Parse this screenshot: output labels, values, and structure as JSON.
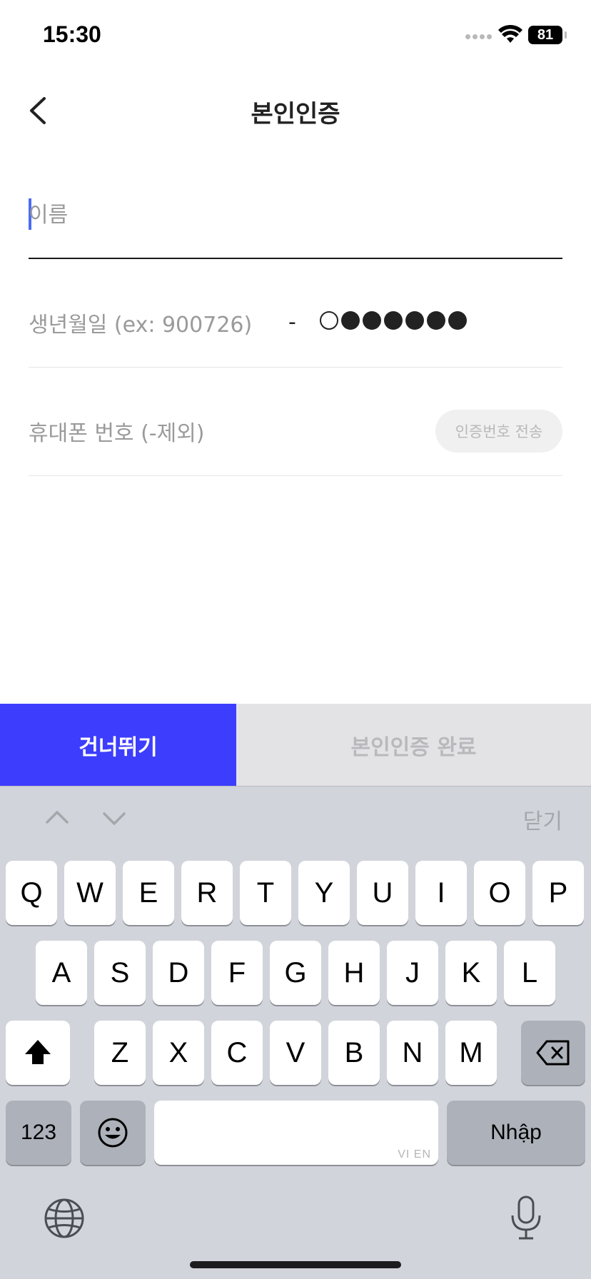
{
  "status_bar": {
    "time": "15:30",
    "battery": "81"
  },
  "nav": {
    "title": "본인인증"
  },
  "form": {
    "name_placeholder": "이름",
    "birth_placeholder": "생년월일 (ex: 900726)",
    "rrn_separator": "-",
    "rrn_dots": [
      "empty",
      "filled",
      "filled",
      "filled",
      "filled",
      "filled",
      "filled"
    ],
    "phone_placeholder": "휴대폰 번호 (-제외)",
    "send_code_label": "인증번호 전송"
  },
  "actions": {
    "skip_label": "건너뛰기",
    "complete_label": "본인인증 완료"
  },
  "accessory": {
    "close_label": "닫기"
  },
  "keyboard": {
    "row1": [
      "Q",
      "W",
      "E",
      "R",
      "T",
      "Y",
      "U",
      "I",
      "O",
      "P"
    ],
    "row2": [
      "A",
      "S",
      "D",
      "F",
      "G",
      "H",
      "J",
      "K",
      "L"
    ],
    "row3": [
      "Z",
      "X",
      "C",
      "V",
      "B",
      "N",
      "M"
    ],
    "numbers_label": "123",
    "space_hint": "VI EN",
    "return_label": "Nhập"
  },
  "colors": {
    "accent": "#3d3dfd",
    "cursor": "#4a6cf7"
  }
}
